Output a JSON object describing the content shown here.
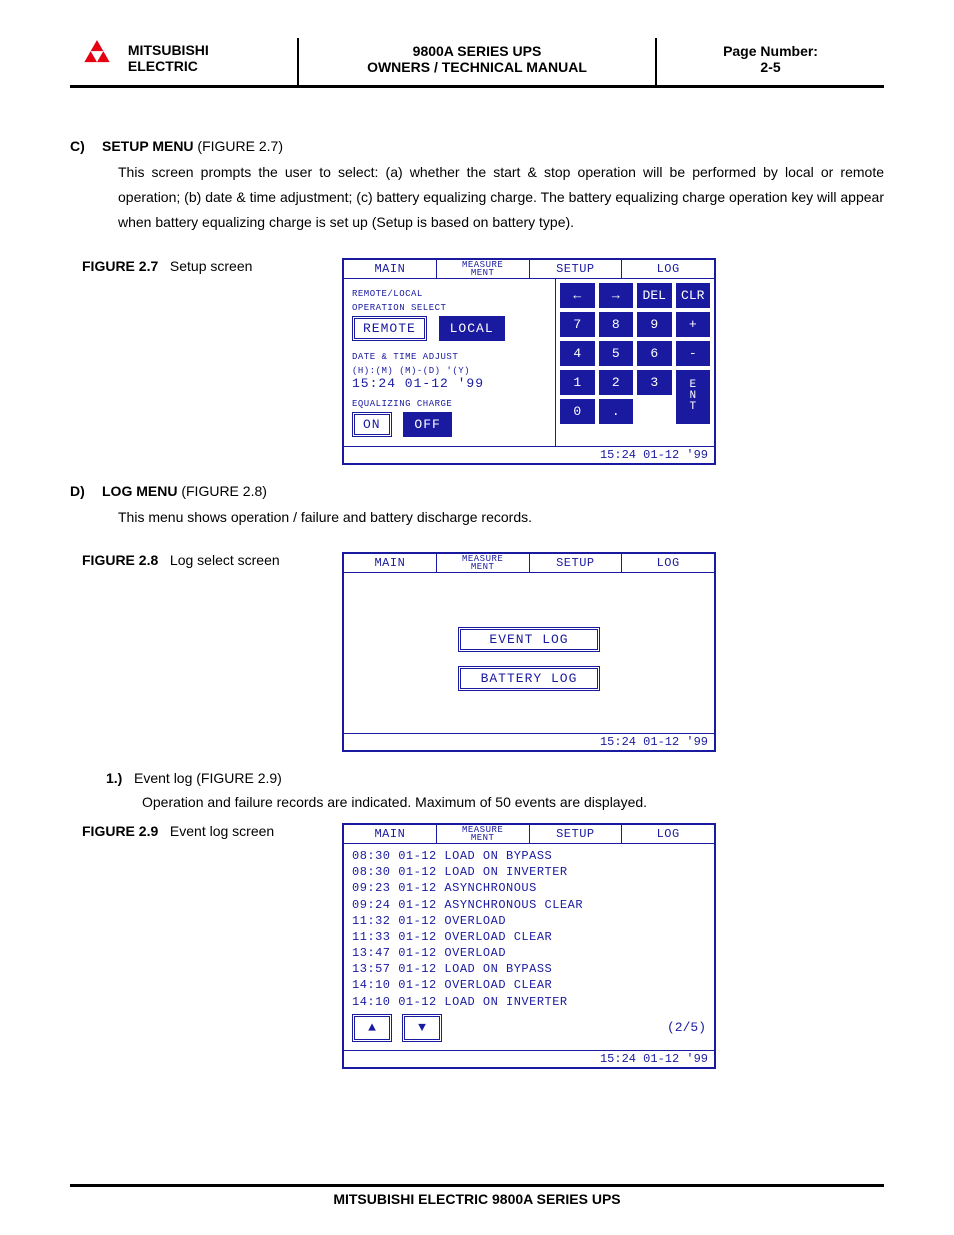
{
  "header": {
    "brand_line1": "MITSUBISHI",
    "brand_line2": "ELECTRIC",
    "title_line1": "9800A SERIES UPS",
    "title_line2": "OWNERS / TECHNICAL MANUAL",
    "page_label": "Page Number:",
    "page_number": "2-5"
  },
  "footer": {
    "text": "MITSUBISHI ELECTRIC 9800A SERIES UPS"
  },
  "section_c": {
    "letter": "C)",
    "title": "SETUP MENU",
    "fig_ref": " (FIGURE 2.7)",
    "body": "This screen prompts the user to select: (a) whether the start & stop operation will be performed by local or remote operation; (b) date & time adjustment; (c) battery equalizing charge. The battery equalizing charge operation key will appear when battery equalizing charge is set up (Setup is based on battery type).",
    "fig_caption_label": "FIGURE 2.7",
    "fig_caption_text": "Setup  screen"
  },
  "section_d": {
    "letter": "D)",
    "title": "LOG MENU",
    "fig_ref": " (FIGURE 2.8)",
    "body": "This menu shows operation / failure and battery discharge records.",
    "fig8_caption_label": "FIGURE 2.8",
    "fig8_caption_text": "Log select screen",
    "sub1_num": "1.)",
    "sub1_title": "Event log (FIGURE 2.9)",
    "sub1_body": "Operation and failure records are indicated. Maximum of 50 events are displayed.",
    "fig9_caption_label": "FIGURE 2.9",
    "fig9_caption_text": "Event log screen"
  },
  "lcd_tabs": {
    "main": "MAIN",
    "measure_l1": "MEASURE",
    "measure_l2": "MENT",
    "setup": "SETUP",
    "log": "LOG"
  },
  "lcd_setup": {
    "rl_label_l1": "REMOTE/LOCAL",
    "rl_label_l2": "OPERATION SELECT",
    "remote_btn": "REMOTE",
    "local_btn": "LOCAL",
    "dt_label_l1": "DATE & TIME ADJUST",
    "dt_label_l2": "(H):(M) (M)-(D)  '(Y)",
    "dt_value": "15:24  01-12  '99",
    "eq_label": "EQUALIZING CHARGE",
    "on_btn": "ON",
    "off_btn": "OFF",
    "keypad": [
      "←",
      "→",
      "DEL",
      "CLR",
      "7",
      "8",
      "9",
      "+",
      "4",
      "5",
      "6",
      "-",
      "1",
      "2",
      "3",
      "E\nN\nT",
      "0",
      ".",
      "",
      ""
    ],
    "status": "15:24 01-12 '99"
  },
  "lcd_log_select": {
    "event_btn": "EVENT LOG",
    "battery_btn": "BATTERY LOG",
    "status": "15:24 01-12 '99"
  },
  "lcd_event_log": {
    "lines": [
      "08:30 01-12 LOAD ON BYPASS",
      "08:30 01-12 LOAD ON INVERTER",
      "09:23 01-12 ASYNCHRONOUS",
      "09:24 01-12 ASYNCHRONOUS CLEAR",
      "11:32 01-12 OVERLOAD",
      "11:33 01-12 OVERLOAD CLEAR",
      "13:47 01-12 OVERLOAD",
      "13:57 01-12 LOAD ON BYPASS",
      "14:10 01-12 OVERLOAD CLEAR",
      "14:10 01-12 LOAD ON INVERTER"
    ],
    "page_indicator": "(2/5)",
    "status": "15:24 01-12 '99"
  }
}
